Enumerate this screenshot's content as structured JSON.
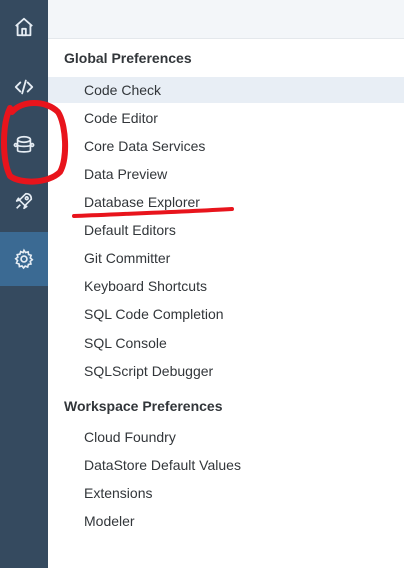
{
  "sidebar": {
    "items": [
      {
        "icon": "home-icon"
      },
      {
        "icon": "code-icon"
      },
      {
        "icon": "database-icon"
      },
      {
        "icon": "rocket-icon"
      },
      {
        "icon": "gear-icon"
      }
    ],
    "active_index": 4
  },
  "preferences": {
    "global_header": "Global Preferences",
    "global_items": [
      "Code Check",
      "Code Editor",
      "Core Data Services",
      "Data Preview",
      "Database Explorer",
      "Default Editors",
      "Git Committer",
      "Keyboard Shortcuts",
      "SQL Code Completion",
      "SQL Console",
      "SQLScript Debugger"
    ],
    "workspace_header": "Workspace Preferences",
    "workspace_items": [
      "Cloud Foundry",
      "DataStore Default Values",
      "Extensions",
      "Modeler"
    ],
    "selected_item": "Code Check"
  },
  "annotations": {
    "color": "#e8141c"
  }
}
